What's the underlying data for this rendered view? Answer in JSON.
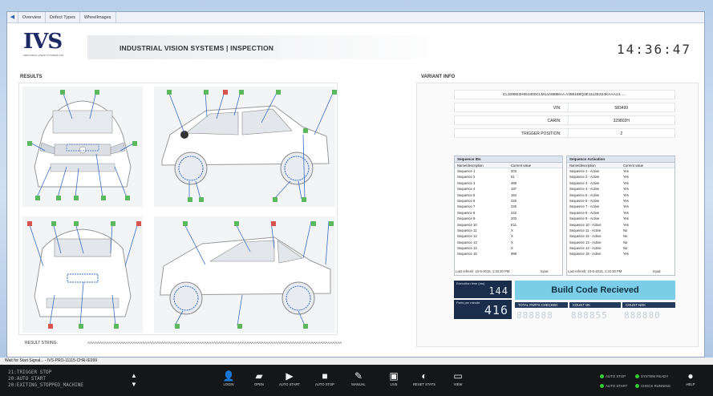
{
  "window": {
    "tabs": [
      "Overview",
      "Defect Types",
      "WheelImages"
    ]
  },
  "header": {
    "logo_text": "IVS",
    "logo_sub": "INDUSTRIAL VISION SYSTEMS LTD",
    "title": "INDUSTRIAL VISION SYSTEMS | INSPECTION",
    "clock": "14:36:47"
  },
  "results": {
    "label": "RESULTS",
    "result_string_label": "RESULT STRING:",
    "result_string_value": "AAAAAAAAAAAAAAAAAAAAAAAAAAAAAAAAAAAAAAAAAAAAAAAAAAAAAAAAAAAAAAAAAAAAAAAAAAAAAAAAAAAAAAAAAAAAAAAAAAAAAAAAAAA"
  },
  "variant": {
    "label": "VARIANT INFO",
    "barcode": "CL329802H553400CLM14A8888AA  A358188Q3E1112E224KAAA14......",
    "vin_label": "VIN:",
    "vin": "583499",
    "carin_label": "CARIN:",
    "carin": "329802H",
    "trigger_label": "TRIGGER POSITION:",
    "trigger": "2"
  },
  "seq_ids": {
    "title": "Sequence IDs",
    "col1": "Name/description",
    "col2": "Current value",
    "rows": [
      [
        "Sequence 1",
        "203"
      ],
      [
        "Sequence 2",
        "51"
      ],
      [
        "Sequence 3",
        "468"
      ],
      [
        "Sequence 4",
        "187"
      ],
      [
        "Sequence 5",
        "164"
      ],
      [
        "Sequence 6",
        "425"
      ],
      [
        "Sequence 7",
        "226"
      ],
      [
        "Sequence 8",
        "242"
      ],
      [
        "Sequence 9",
        "203"
      ],
      [
        "Sequence 10",
        "E11"
      ],
      [
        "Sequence 11",
        "X"
      ],
      [
        "Sequence 12",
        "X"
      ],
      [
        "Sequence 13",
        "X"
      ],
      [
        "Sequence 14",
        "X"
      ],
      [
        "Sequence 15",
        "999"
      ]
    ],
    "footer": "Last refresh: 10-5-2015, 1:34:30 PM",
    "input_label": "Input:"
  },
  "seq_act": {
    "title": "Sequence Activation",
    "col1": "Name/description",
    "col2": "Current value",
    "rows": [
      [
        "Sequence 1 - Active",
        "Yes"
      ],
      [
        "Sequence 2 - Active",
        "Yes"
      ],
      [
        "Sequence 3 - Active",
        "Yes"
      ],
      [
        "Sequence 4 - Active",
        "Yes"
      ],
      [
        "Sequence 5 - Active",
        "Yes"
      ],
      [
        "Sequence 6 - Active",
        "Yes"
      ],
      [
        "Sequence 7 - Active",
        "Yes"
      ],
      [
        "Sequence 8 - Active",
        "Yes"
      ],
      [
        "Sequence 9 - Active",
        "Yes"
      ],
      [
        "Sequence 10 - Active",
        "Yes"
      ],
      [
        "Sequence 11 - Active",
        "No"
      ],
      [
        "Sequence 12 - Active",
        "No"
      ],
      [
        "Sequence 13 - Active",
        "No"
      ],
      [
        "Sequence 14 - Active",
        "No"
      ],
      [
        "Sequence 15 - Active",
        "Yes"
      ]
    ],
    "footer": "Last refresh: 10-5-2015, 1:34:30 PM",
    "input_label": "Input:"
  },
  "metrics": {
    "exec_label": "Execution time (ms)",
    "exec_value": "144",
    "ppm_label": "Parts per minute",
    "ppm_value": "416",
    "build_status": "Build Code Recieved",
    "total_label": "TOTAL PARTS CHECKED",
    "total_value": "888888",
    "ok_label": "COUNT OK",
    "ok_value": "888855",
    "nok_label": "COUNT NOK",
    "nok_value": "888880"
  },
  "statusbar": "Wait for Start Signal... - IVS-PRO-11115-CHR-IE999",
  "taskbar": {
    "left_lines": [
      "21:TRIGGER STOP",
      "20:AUTO START",
      "20:EXITING_STOPPED_MACHINE"
    ],
    "buttons": [
      "LOGIN",
      "OPEN",
      "AUTO START",
      "AUTO STOP",
      "MANUAL",
      "LIVE",
      "RESET STATS",
      "VIEW"
    ],
    "leds": [
      "AUTO STOP",
      "AUTO START",
      "SYSTEM READY",
      "CHECK RUNNING"
    ],
    "help": "HELP"
  }
}
